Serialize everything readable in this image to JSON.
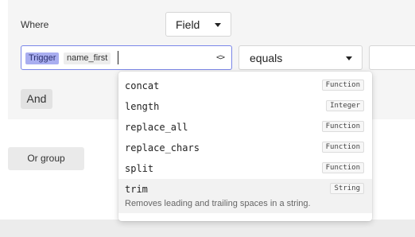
{
  "filter": {
    "where_label": "Where",
    "field_select": "Field",
    "expression": {
      "trigger_token": "Trigger",
      "field_token": "name_first"
    },
    "operator_select": "equals",
    "value": "",
    "and_button": "And",
    "or_group_button": "Or group"
  },
  "autocomplete": {
    "options": [
      {
        "name": "concat",
        "type": "Function"
      },
      {
        "name": "length",
        "type": "Integer"
      },
      {
        "name": "replace_all",
        "type": "Function"
      },
      {
        "name": "replace_chars",
        "type": "Function"
      },
      {
        "name": "split",
        "type": "Function"
      },
      {
        "name": "trim",
        "type": "String",
        "description": "Removes leading and trailing spaces in a string."
      }
    ]
  },
  "colors": {
    "accent_border": "#7a86e8",
    "trigger_token_bg": "#a9aef0"
  },
  "icons": {
    "expression_toggle": "code-brackets-icon",
    "dropdown_caret": "caret-down-icon"
  }
}
